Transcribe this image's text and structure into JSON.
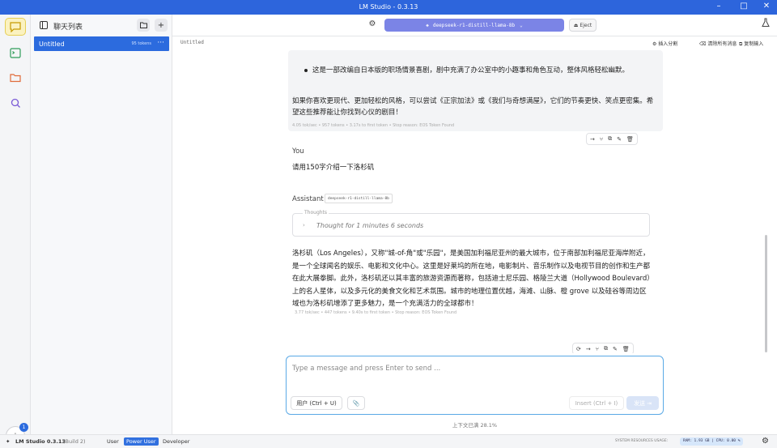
{
  "window": {
    "title": "LM Studio - 0.3.13"
  },
  "sidebar": {
    "header_label": "聊天列表",
    "chats": [
      {
        "name": "Untitled",
        "tokens": "95 tokens"
      }
    ]
  },
  "topbar": {
    "model_name": "deepseek-r1-distill-llama-8b",
    "eject_label": "Eject"
  },
  "subbar": {
    "chat_title": "Untitled",
    "actions": [
      "插入分割",
      "清除所有消息",
      "复制输入"
    ]
  },
  "messages": {
    "prev_bullet": "这是一部改编自日本版的职场情景喜剧，剧中充满了办公室中的小趣事和角色互动，整体风格轻松幽默。",
    "prev_para": "如果你喜欢更现代、更加轻松的风格，可以尝试《正宗加法》或《我们与奇想满屋》，它们的节奏更快、笑点更密集。希望这些推荐能让你找到心仪的剧目！",
    "prev_stats": "4.05 tok/sec • 957 tokens • 3.17s to first token • Stop reason: EOS Token Found",
    "user_label": "You",
    "user_text": "请用150字介绍一下洛杉矶",
    "assistant_label": "Assistant",
    "assistant_model_tag": "deepseek-r1-distill-llama-8b",
    "thoughts_header": "Thoughts",
    "thoughts_text": "Thought for 1 minutes 6 seconds",
    "answer": "洛杉矶（Los Angeles），又称\"城-of-角\"或\"乐园\"，是美国加利福尼亚州的最大城市，位于南部加利福尼亚海岸附近，是一个全球闻名的娱乐、电影和文化中心。这里是好莱坞的所在地，电影制片、音乐制作以及电视节目的创作和生产都在此大展拳脚。此外，洛杉矶还以其丰富的旅游资源而著称，包括迪士尼乐园、格陵兰大道（Hollywood Boulevard）上的名人星体，以及多元化的美食文化和艺术氛围。城市的地理位置优越，海滩、山脉、橙 grove 以及硅谷等周边区域也为洛杉矶增添了更多魅力，是一个充满活力的全球都市！",
    "answer_stats": "3.77 tok/sec • 447 tokens • 9.40s to first token • Stop reason: EOS Token Found"
  },
  "composer": {
    "placeholder": "Type a message and press Enter to send ...",
    "user_btn": "用户 (Ctrl + U)",
    "insert_btn": "Insert (Ctrl + I)",
    "send_btn": "发送"
  },
  "context_usage": "上下文已满 28.1%",
  "statusbar": {
    "app": "LM Studio 0.3.13",
    "build": "(Build 2)",
    "mode_user": "User",
    "mode_power": "Power User",
    "mode_dev": "Developer",
    "sys_label": "SYSTEM RESOURCES USAGE:",
    "resources": "RAM: 1.93 GB | CPU: 0.00 %"
  },
  "downloads_badge": "1",
  "colors": {
    "accent": "#2c6bde",
    "model_pill": "#7b84e6",
    "titlebar": "#2d65dc"
  }
}
